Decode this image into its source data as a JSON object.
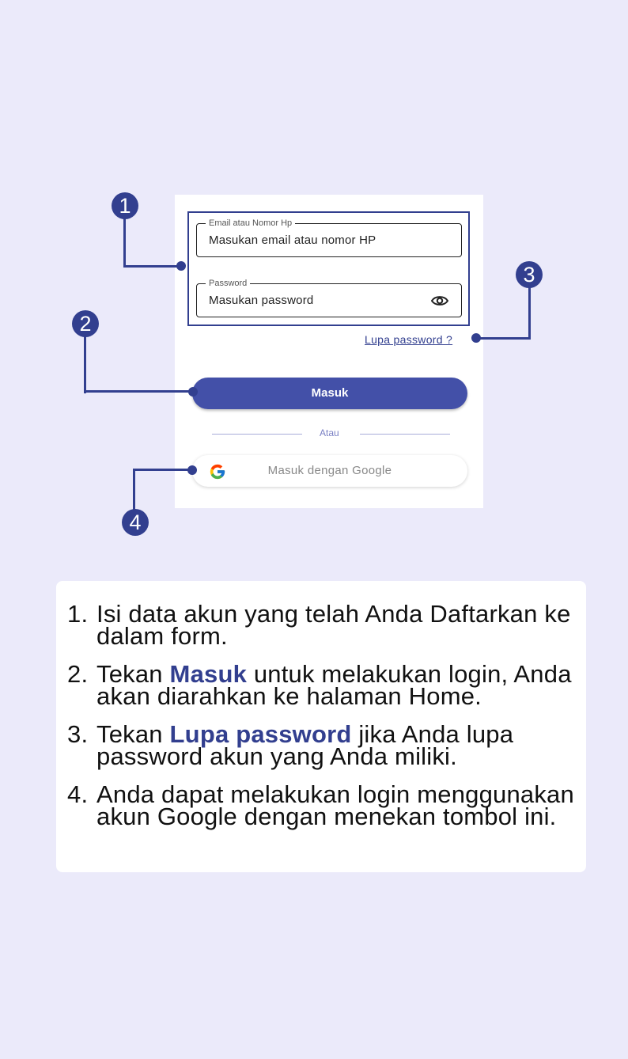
{
  "form": {
    "email_legend": "Email atau Nomor Hp",
    "email_value": "Masukan email atau nomor HP",
    "password_legend": "Password",
    "password_value": "Masukan password",
    "forgot_label": "Lupa password ?",
    "login_label": "Masuk",
    "divider_label": "Atau",
    "google_label": "Masuk dengan Google"
  },
  "badges": [
    "1",
    "2",
    "3",
    "4"
  ],
  "steps": [
    {
      "num": "1.",
      "before": "Isi data akun yang telah Anda Daftarkan ke dalam form.",
      "emph": "",
      "after": ""
    },
    {
      "num": "2.",
      "before": "Tekan ",
      "emph": "Masuk",
      "after": " untuk melakukan login, Anda akan diarahkan ke halaman Home."
    },
    {
      "num": "3.",
      "before": "Tekan ",
      "emph": "Lupa password",
      "after": " jika Anda lupa password akun yang  Anda miliki."
    },
    {
      "num": "4.",
      "before": "Anda dapat melakukan login menggunakan akun Google dengan menekan tombol ini.",
      "emph": "",
      "after": ""
    }
  ],
  "colors": {
    "background": "#ebeafa",
    "accent": "#323f8f",
    "button": "#4350a8"
  },
  "icons": [
    "eye-icon",
    "google-icon"
  ]
}
